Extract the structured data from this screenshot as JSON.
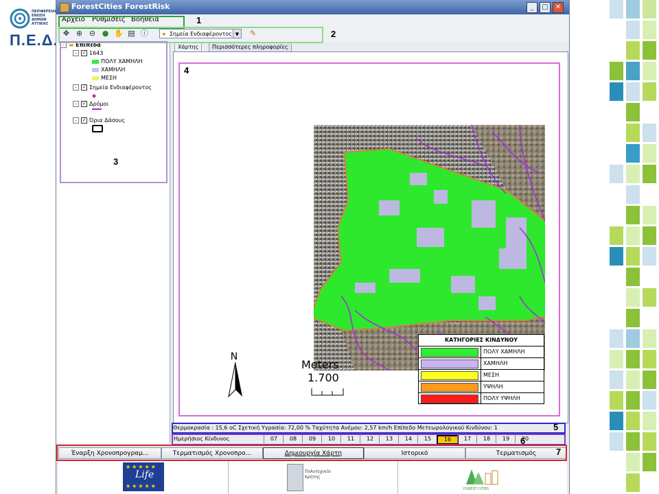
{
  "logo": {
    "abbrev": "Π.Ε.Δ.",
    "lines": "ΠΕΡΙΦΕΡΕΙΑΚΗ ΕΝΩΣΗ ΔΗΜΩΝ ΑΤΤΙΚΗΣ"
  },
  "window": {
    "title": "ForestCities ForestRisk"
  },
  "menu": [
    "Αρχείο",
    "Ρυθμίσεις",
    "Βοήθεια"
  ],
  "toolbar": {
    "poi_combo": "Σημεία Ενδιαφέροντος"
  },
  "layers": {
    "root": "Επίπεδα",
    "group": "1643",
    "classes": [
      {
        "label": "ΠΟΛΥ ΧΑΜΗΛΗ",
        "color": "#3ee84a"
      },
      {
        "label": "ΧΑΜΗΛΗ",
        "color": "#c9c4ee"
      },
      {
        "label": "ΜΕΣΗ",
        "color": "#f5f06a"
      }
    ],
    "poi": "Σημεία Ενδιαφέροντος",
    "roads": "Δρόμοι",
    "forest": "Όρια Δάσους"
  },
  "tabs": [
    "Χάρτης",
    "Περισσότερες πληροφορίες"
  ],
  "map": {
    "north": "N",
    "scale_unit": "Meters",
    "scale_value": "1.700"
  },
  "legend": {
    "title": "ΚΑΤΗΓΟΡΙΕΣ ΚΙΝΔΥΝΟΥ",
    "items": [
      {
        "label": "ΠΟΛΥ ΧΑΜΗΛΗ",
        "color": "#2df02d"
      },
      {
        "label": "ΧΑΜΗΛΗ",
        "color": "#c8b6ee"
      },
      {
        "label": "ΜΕΣΗ",
        "color": "#ffff1e"
      },
      {
        "label": "ΥΨΗΛΗ",
        "color": "#ff9a1a"
      },
      {
        "label": "ΠΟΛΥ ΥΨΗΛΗ",
        "color": "#ff1a1a"
      }
    ]
  },
  "status": "Θερμοκρασία : 15,6 oC  Σχετική Υγρασία: 72,00 %  Ταχύτητα Ανέμου: 2,57 km/h   Επίπεδο Μετεωρολογικού Κινδύνου: 1",
  "days": {
    "label": "Ημερήσιος Κίνδυνος",
    "values": [
      "07",
      "08",
      "09",
      "10",
      "11",
      "12",
      "13",
      "14",
      "15",
      "16",
      "17",
      "18",
      "19",
      "20"
    ],
    "selected": "16"
  },
  "buttons": [
    "Έναρξη Χρονοπρογραμ...",
    "Τερματισμός Χρονοπρο...",
    "Δημιουργία Χάρτη",
    "Ιστορικό",
    "Τερματισμός"
  ],
  "footer": {
    "polytechnic": "Πολυτεχνείο Κρήτης",
    "forest_cities": "FOREST CITIES",
    "life": "Life"
  },
  "annotations": [
    "1",
    "2",
    "3",
    "4",
    "5",
    "6",
    "7"
  ]
}
